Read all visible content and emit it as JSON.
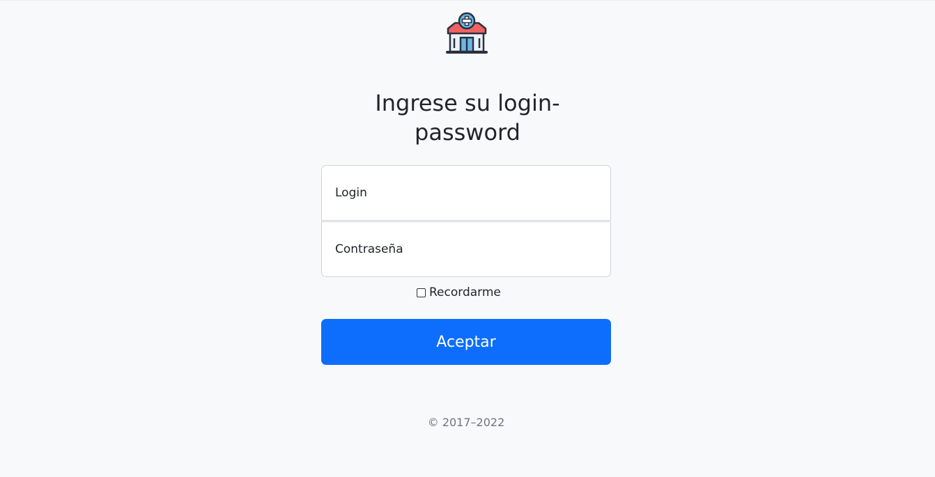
{
  "logo": {
    "icon": "hospital-icon"
  },
  "form": {
    "heading_line1": "Ingrese su login-",
    "heading_line2": "password",
    "login_placeholder": "Login",
    "password_placeholder": "Contraseña",
    "remember_label": "Recordarme",
    "remember_checked": false,
    "submit_label": "Aceptar"
  },
  "footer": {
    "copyright": "© 2017–2022"
  },
  "colors": {
    "background": "#f8f9fa",
    "primary": "#0d6efd",
    "muted_text": "#6c757d",
    "logo_roof": "#f06262",
    "logo_outline": "#2d2f3f",
    "logo_window": "#6ab7e6"
  }
}
